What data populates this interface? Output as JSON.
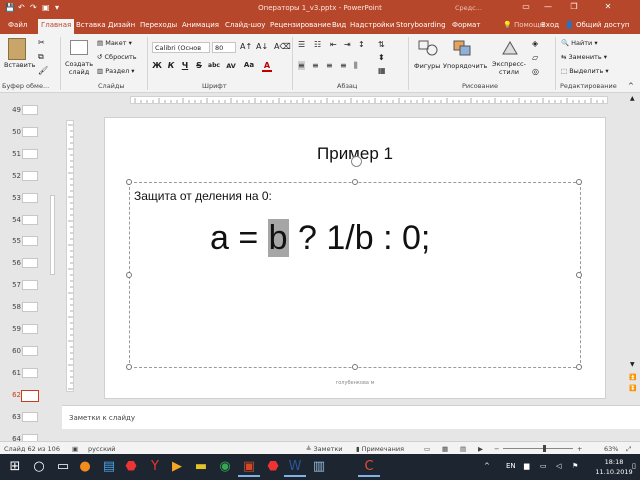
{
  "window": {
    "title": "Операторы 1_v3.pptx - PowerPoint",
    "tools_label": "Средс...",
    "sign_in": "Вход",
    "minimize": "—",
    "restore": "❐",
    "close": "✕",
    "brand_color": "#b7472a"
  },
  "tabs": [
    "Файл",
    "Главная",
    "Вставка",
    "Дизайн",
    "Переходы",
    "Анимация",
    "Слайд-шоу",
    "Рецензирование",
    "Вид",
    "Надстройки",
    "Storyboarding",
    "Формат"
  ],
  "help": "Помощн",
  "share": "Общий доступ",
  "ribbon": {
    "paste": "Вставить",
    "clipboard_group": "Буфер обме...",
    "create_slide": "Создать слайд",
    "layout": "Макет",
    "reset": "Сбросить",
    "section": "Раздел",
    "slides_group": "Слайды",
    "font_name": "Calibri (Основ",
    "font_size": "80",
    "bold": "Ж",
    "italic": "К",
    "underline": "Ч",
    "strike": "S",
    "shadow": "abc",
    "spacing": "AV",
    "case": "Aa",
    "font_color": "A",
    "font_group": "Шрифт",
    "paragraph_group": "Абзац",
    "shapes": "Фигуры",
    "arrange": "Упорядочить",
    "quick_styles": "Экспресс-стили",
    "drawing_group": "Рисование",
    "find": "Найти",
    "replace": "Заменить",
    "select": "Выделить",
    "editing_group": "Редактирование"
  },
  "thumbnails": {
    "numbers": [
      "49",
      "50",
      "51",
      "52",
      "53",
      "54",
      "55",
      "56",
      "57",
      "58",
      "59",
      "60",
      "61",
      "62",
      "63",
      "64"
    ],
    "current": "62"
  },
  "slide": {
    "title": "Пример 1",
    "body_line1": "Защита от деления на 0:",
    "formula_before": "a = ",
    "formula_selected": "b",
    "formula_after": " ? 1/b : 0;",
    "footer": "голубенкова м"
  },
  "notes": {
    "placeholder": "Заметки к слайду"
  },
  "status": {
    "slide_info": "Слайд 62 из 106",
    "language": "русский",
    "notes_btn": "Заметки",
    "comments_btn": "Примечания",
    "zoom": "63%"
  },
  "taskbar": {
    "lang": "EN",
    "time": "18:18",
    "date": "11.10.2019"
  },
  "colors": {
    "accent": "#c43e1c",
    "selection": "#a6a6a6"
  }
}
